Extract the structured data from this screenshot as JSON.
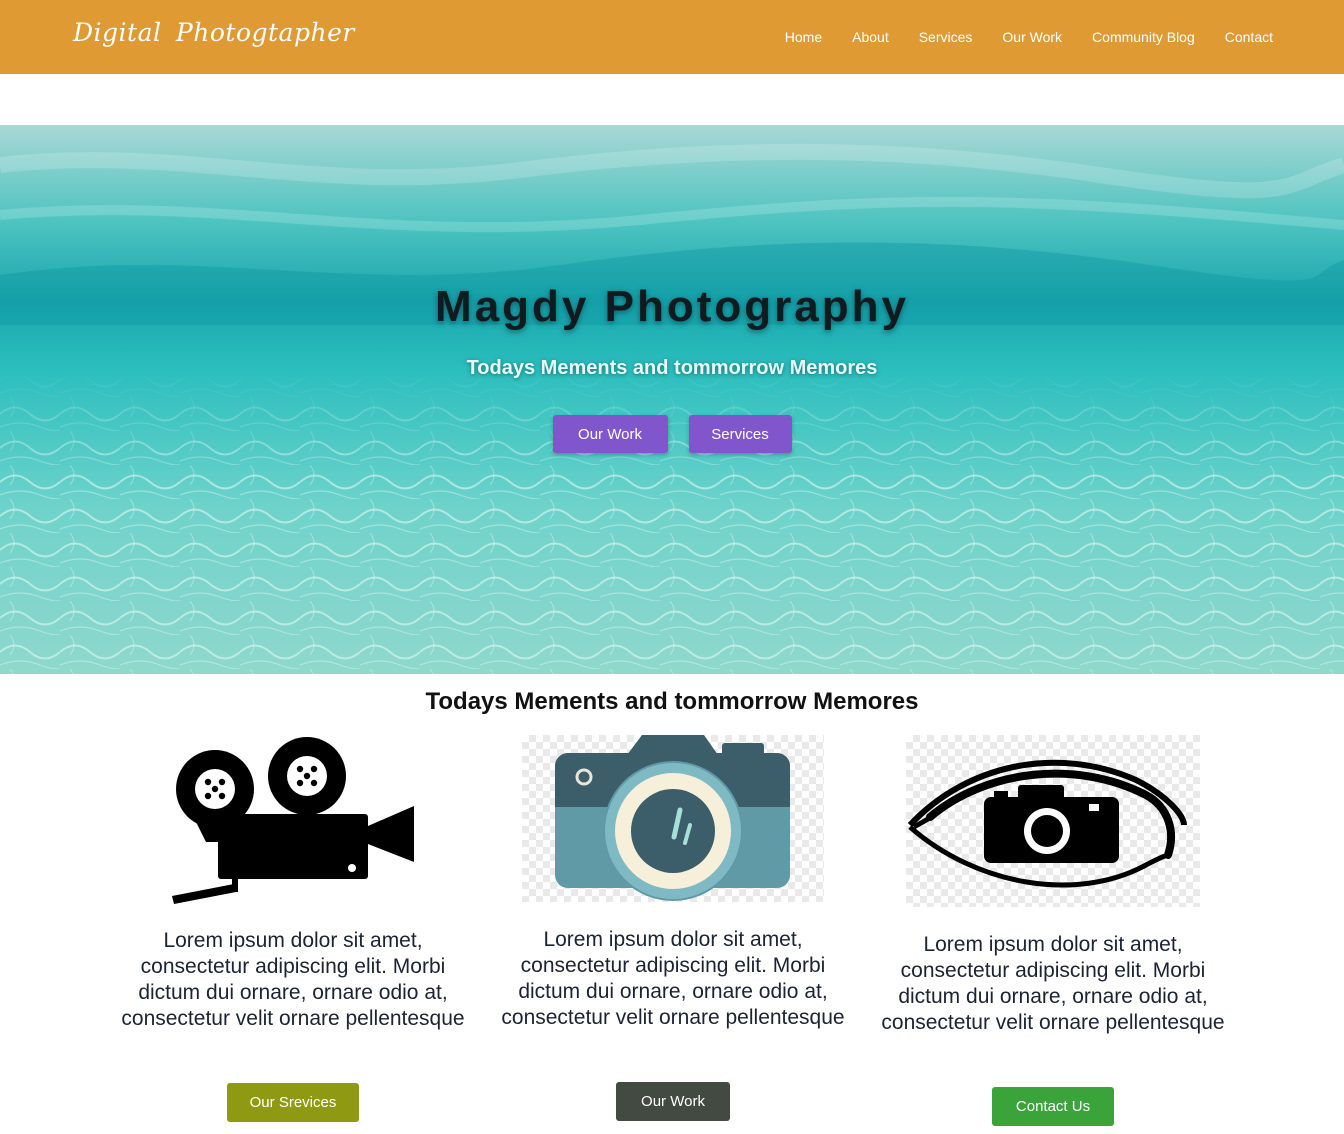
{
  "navbar": {
    "brand": "Digital  Photogtapher",
    "links": [
      "Home",
      "About",
      "Services",
      "Our Work",
      "Community Blog",
      "Contact"
    ]
  },
  "hero": {
    "title": "Magdy Photography",
    "subtitle": "Todays Mements and tommorrow Memores",
    "buttons": [
      "Our Work",
      "Services"
    ]
  },
  "section": {
    "title": "Todays Mements and tommorrow Memores"
  },
  "features": [
    {
      "icon": "movie-camera-icon",
      "text": "Lorem ipsum dolor sit amet, consectetur adipiscing elit. Morbi dictum dui ornare, ornare odio at, consectetur velit ornare pellentesque",
      "button": "Our Srevices",
      "button_color": "#8f9a12"
    },
    {
      "icon": "photo-camera-icon",
      "text": "Lorem ipsum dolor sit amet, consectetur adipiscing elit. Morbi dictum dui ornare, ornare odio at, consectetur velit ornare pellentesque",
      "button": "Our Work",
      "button_color": "#434a42"
    },
    {
      "icon": "eye-camera-icon",
      "text": "Lorem ipsum dolor sit amet, consectetur adipiscing elit. Morbi dictum dui ornare, ornare odio at, consectetur velit ornare pellentesque",
      "button": "Contact Us",
      "button_color": "#3aa43a"
    }
  ],
  "colors": {
    "navbar": "#df9a34",
    "hero_button": "#8156cc",
    "water": "#2cc0c0"
  }
}
